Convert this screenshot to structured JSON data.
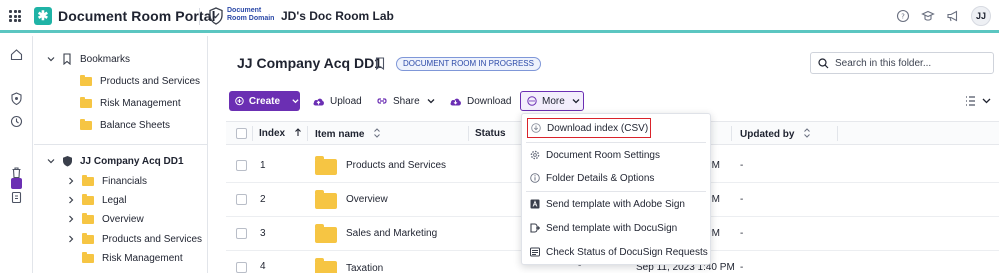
{
  "header": {
    "app_title": "Document Room Portal",
    "domain_label": "Document Room Domain",
    "domain_title": "JD's Doc Room Lab",
    "avatar_initials": "JJ",
    "accent_color": "#5bc6c1",
    "brand_color": "#6b2fb3"
  },
  "tree": {
    "bookmarks_label": "Bookmarks",
    "bookmarks": [
      "Products and Services",
      "Risk Management",
      "Balance Sheets"
    ],
    "room_label": "JJ Company Acq DD1",
    "room_folders": [
      "Financials",
      "Legal",
      "Overview",
      "Products and Services",
      "Risk Management"
    ]
  },
  "main": {
    "folder_title": "JJ Company Acq DD1",
    "badge": "DOCUMENT ROOM IN PROGRESS",
    "search_placeholder": "Search in this folder..."
  },
  "toolbar": {
    "create": "Create",
    "upload": "Upload",
    "share": "Share",
    "download": "Download",
    "more": "More"
  },
  "table": {
    "columns": [
      "Index",
      "Item name",
      "Status",
      "Updated by"
    ],
    "rows": [
      {
        "index": "1",
        "name": "Products and Services",
        "status": "",
        "date": "PM",
        "updated_by": "-"
      },
      {
        "index": "2",
        "name": "Overview",
        "status": "",
        "date": "PM",
        "updated_by": "-"
      },
      {
        "index": "3",
        "name": "Sales and Marketing",
        "status": "",
        "date": "PM",
        "updated_by": "-"
      },
      {
        "index": "4",
        "name": "Taxation",
        "status": "-",
        "date": "Sep 11, 2023 1:40 PM",
        "updated_by": "-"
      }
    ]
  },
  "menu": {
    "items": [
      "Download index (CSV)",
      "Document Room Settings",
      "Folder Details & Options",
      "Send template with Adobe Sign",
      "Send template with DocuSign",
      "Check Status of DocuSign Requests"
    ]
  }
}
